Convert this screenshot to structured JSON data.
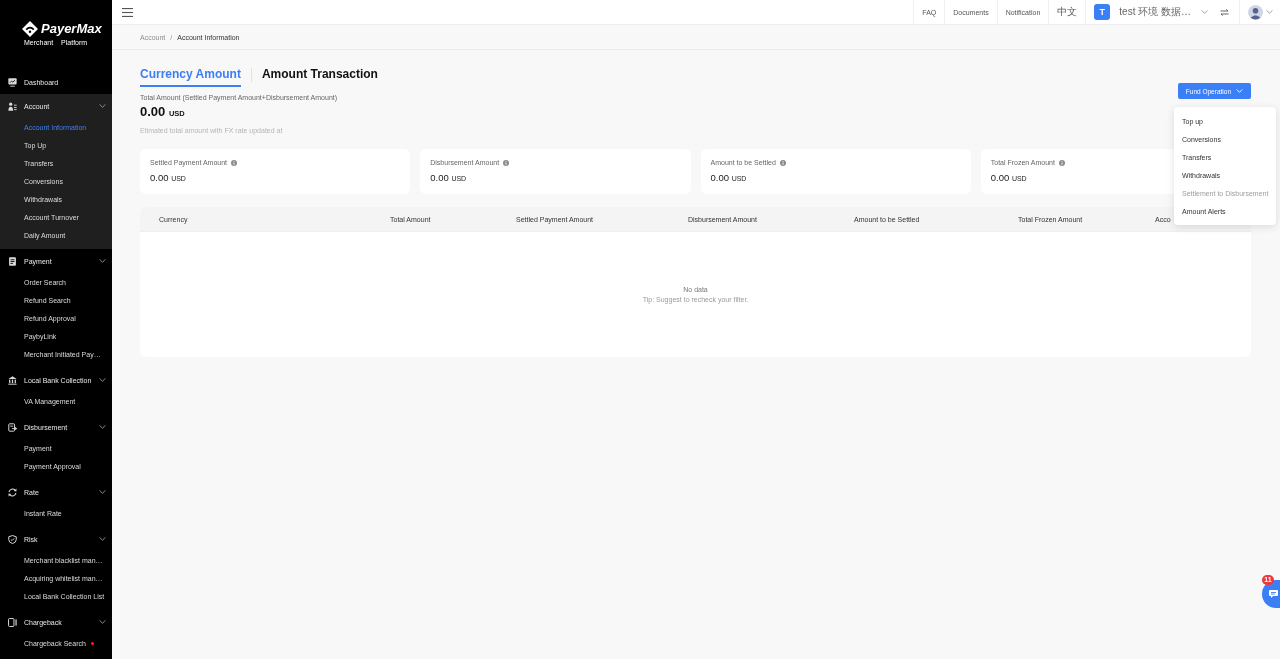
{
  "sidebar": {
    "logo": {
      "name": "PayerMax",
      "subtitle": "Merchant  Platform"
    },
    "menu": [
      {
        "label": "Dashboard",
        "selected": false
      },
      {
        "label": "Account",
        "selected": true,
        "expanded": true,
        "children": [
          {
            "label": "Account Information",
            "selected": true,
            "dot": false
          },
          {
            "label": "Top Up",
            "selected": false,
            "dot": false
          },
          {
            "label": "Transfers",
            "selected": false,
            "dot": false
          },
          {
            "label": "Conversions",
            "selected": false,
            "dot": false
          },
          {
            "label": "Withdrawals",
            "selected": false,
            "dot": false
          },
          {
            "label": "Account Turnover",
            "selected": false,
            "dot": false
          },
          {
            "label": "Daily Amount",
            "selected": false,
            "dot": false
          }
        ]
      },
      {
        "label": "Payment",
        "selected": false,
        "expanded": true,
        "children": [
          {
            "label": "Order Search",
            "selected": false,
            "dot": false
          },
          {
            "label": "Refund Search",
            "selected": false,
            "dot": false
          },
          {
            "label": "Refund Approval",
            "selected": false,
            "dot": false
          },
          {
            "label": "PaybyLink",
            "selected": false,
            "dot": false
          },
          {
            "label": "Merchant Initiated Pay…",
            "selected": false,
            "dot": false
          }
        ]
      },
      {
        "label": "Local Bank Collection",
        "selected": false,
        "expanded": true,
        "children": [
          {
            "label": "VA Management",
            "selected": false,
            "dot": false
          }
        ]
      },
      {
        "label": "Disbursement",
        "selected": false,
        "expanded": true,
        "children": [
          {
            "label": "Payment",
            "selected": false,
            "dot": false
          },
          {
            "label": "Payment Approval",
            "selected": false,
            "dot": false
          }
        ]
      },
      {
        "label": "Rate",
        "selected": false,
        "expanded": true,
        "children": [
          {
            "label": "Instant Rate",
            "selected": false,
            "dot": false
          }
        ]
      },
      {
        "label": "Risk",
        "selected": false,
        "expanded": true,
        "children": [
          {
            "label": "Merchant blacklist man…",
            "selected": false,
            "dot": false
          },
          {
            "label": "Acquiring whitelist man…",
            "selected": false,
            "dot": false
          },
          {
            "label": "Local Bank Collection List",
            "selected": false,
            "dot": false
          }
        ]
      },
      {
        "label": "Chargeback",
        "selected": false,
        "expanded": true,
        "children": [
          {
            "label": "Chargeback Search",
            "selected": false,
            "dot": true
          }
        ]
      }
    ]
  },
  "header": {
    "links": [
      "FAQ",
      "Documents",
      "Notification",
      "中文"
    ],
    "account": {
      "initial": "T",
      "name": "test 环境 数据…"
    }
  },
  "breadcrumb": {
    "items": [
      "Account",
      "Account Information"
    ],
    "separator": "/"
  },
  "tabs": [
    {
      "label": "Currency Amount",
      "selected": true
    },
    {
      "label": "Amount Transaction",
      "selected": false
    }
  ],
  "total": {
    "label": "Total Amount (Settled Payment Amount+Disbursement Amount)",
    "value": "0.00",
    "currency": "USD",
    "note": "Etimated total amount with FX rate updated at"
  },
  "fund_operation": {
    "label": "Fund Operation",
    "expanded": true,
    "menu": [
      {
        "label": "Top up",
        "disabled": false
      },
      {
        "label": "Conversions",
        "disabled": false
      },
      {
        "label": "Transfers",
        "disabled": false
      },
      {
        "label": "Withdrawals",
        "disabled": false
      },
      {
        "label": "Settlement to Disbursement",
        "disabled": true
      },
      {
        "label": "Amount Alerts",
        "disabled": false
      }
    ]
  },
  "cards": [
    {
      "label": "Settled Payment Amount",
      "value": "0.00",
      "currency": "USD"
    },
    {
      "label": "Disbursement Amount",
      "value": "0.00",
      "currency": "USD"
    },
    {
      "label": "Amount to be Settled",
      "value": "0.00",
      "currency": "USD"
    },
    {
      "label": "Total Frozen Amount",
      "value": "0.00",
      "currency": "USD"
    }
  ],
  "table": {
    "columns": [
      "Currency",
      "Total Amount",
      "Settled Payment Amount",
      "Disbursement Amount",
      "Amount to be Settled",
      "Total Frozen Amount",
      "Acco"
    ],
    "empty": {
      "title": "No data",
      "tip": "Tip: Suggest to recheck your filter."
    }
  },
  "chat_button": {
    "badge": "11"
  }
}
